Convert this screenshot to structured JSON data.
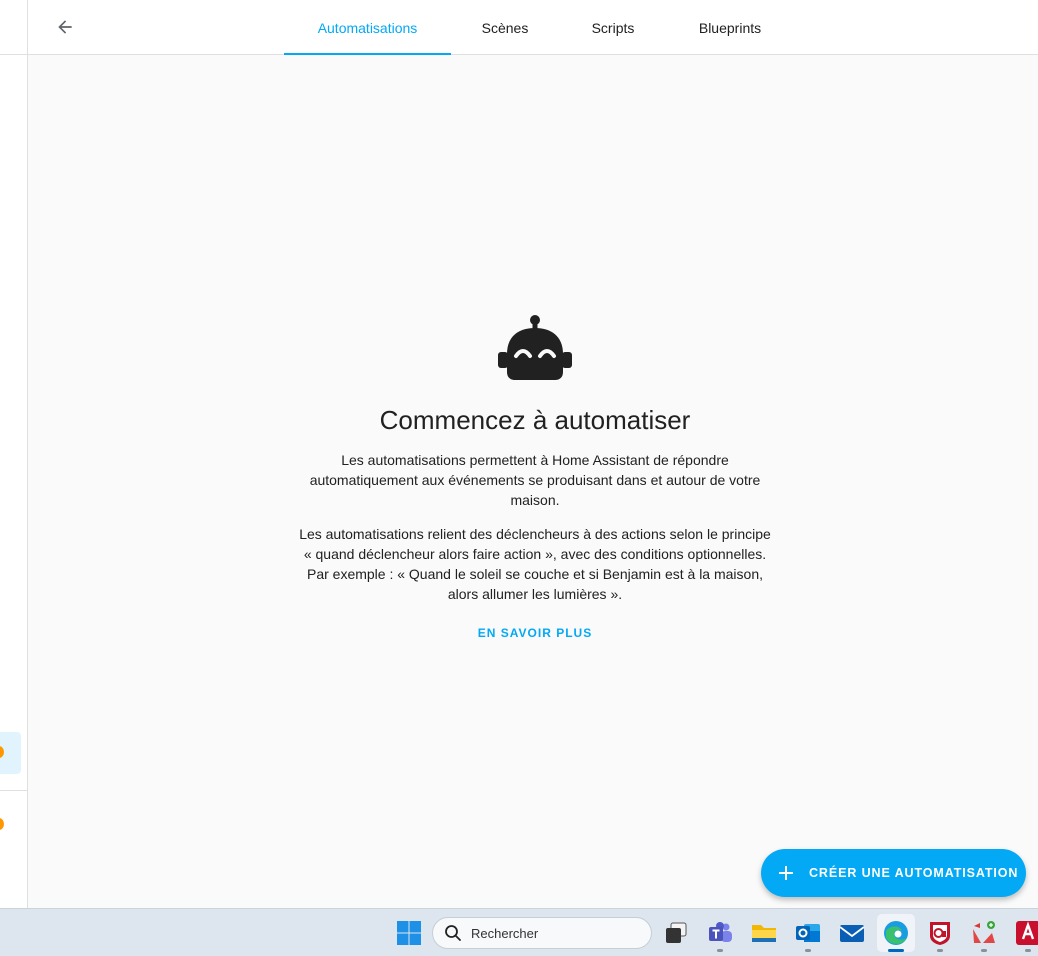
{
  "header": {
    "tabs": [
      {
        "label": "Automatisations",
        "active": true
      },
      {
        "label": "Scènes",
        "active": false
      },
      {
        "label": "Scripts",
        "active": false
      },
      {
        "label": "Blueprints",
        "active": false
      }
    ]
  },
  "empty_state": {
    "title": "Commencez à automatiser",
    "paragraph1": "Les automatisations permettent à Home Assistant de répondre automatiquement aux événements se produisant dans et autour de votre maison.",
    "paragraph2": "Les automatisations relient des déclencheurs à des actions selon le principe « quand déclencheur alors faire action », avec des conditions optionnelles. Par exemple : « Quand le soleil se couche et si Benjamin est à la maison, alors allumer les lumières ».",
    "learn_more": "EN SAVOIR PLUS"
  },
  "fab": {
    "label": "CRÉER UNE AUTOMATISATION"
  },
  "taskbar": {
    "search_placeholder": "Rechercher"
  },
  "colors": {
    "accent": "#03a9f4",
    "background": "#fafafa",
    "text": "#212121"
  }
}
